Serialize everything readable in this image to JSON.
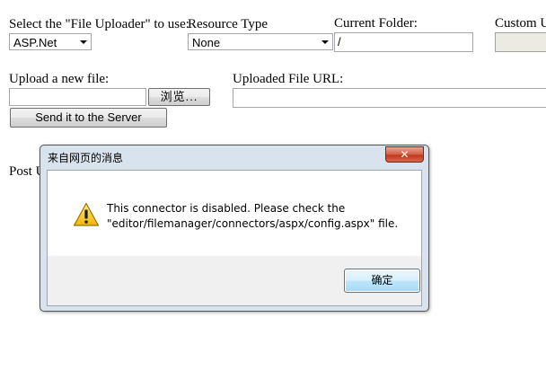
{
  "form": {
    "uploader_label": "Select the \"File Uploader\" to use:",
    "uploader_value": "ASP.Net",
    "resource_type_label": "Resource Type",
    "resource_type_value": "None",
    "current_folder_label": "Current Folder:",
    "current_folder_value": "/",
    "custom_label": "Custom U",
    "upload_label": "Upload a new file:",
    "browse_label": "浏览...",
    "send_label": "Send it to the Server",
    "uploaded_url_label": "Uploaded File URL:",
    "uploaded_url_value": "",
    "post_label": "Post U"
  },
  "dialog": {
    "title": "来自网页的消息",
    "close_glyph": "✕",
    "icon": "warning-icon",
    "message_line1": "This connector is disabled. Please check the",
    "message_line2": "\"editor/filemanager/connectors/aspx/config.aspx\" file.",
    "ok_label": "确定"
  }
}
